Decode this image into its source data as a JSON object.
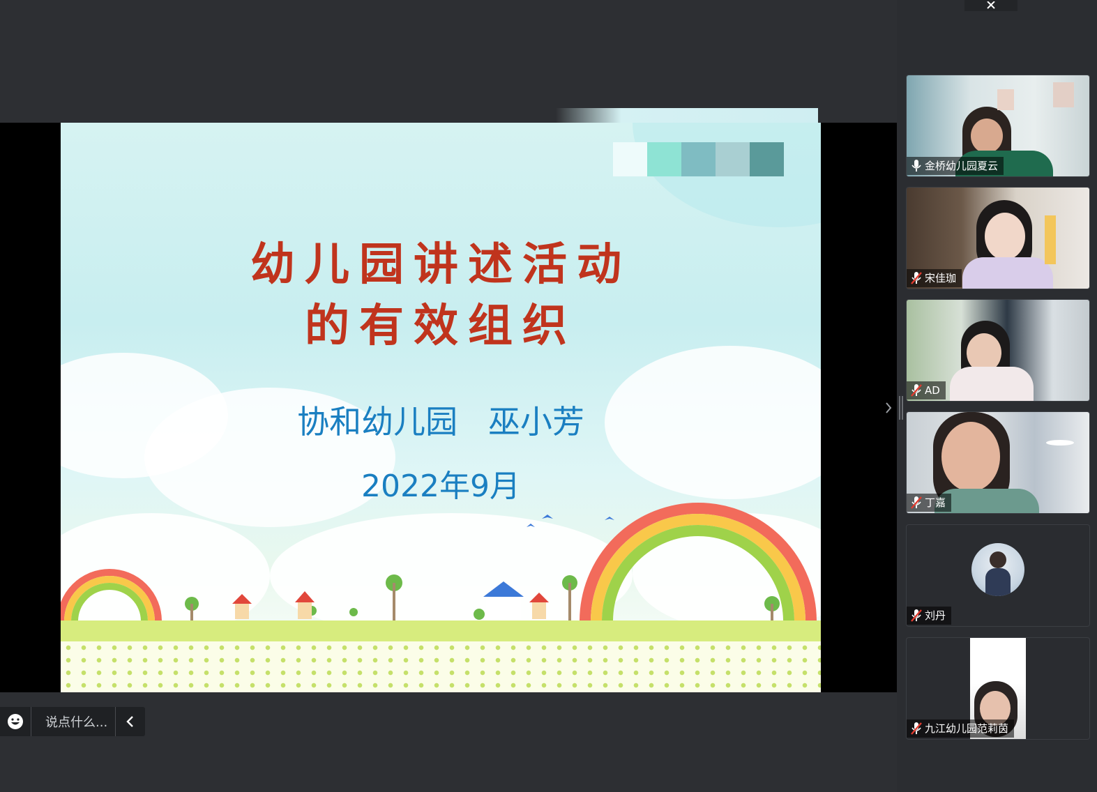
{
  "slide": {
    "title_line1": "幼儿园讲述活动",
    "title_line2": "的有效组织",
    "organization": "协和幼儿园   巫小芳",
    "date": "2022年9月",
    "swatch_colors": [
      "#eefbfb",
      "#8ee3d4",
      "#7fbcc2",
      "#a9cfd2",
      "#5a9a9a"
    ]
  },
  "chat": {
    "placeholder": "说点什么..."
  },
  "participants": [
    {
      "name": "金桥幼儿园夏云",
      "mic": "on"
    },
    {
      "name": "宋佳珈",
      "mic": "muted"
    },
    {
      "name": "AD",
      "mic": "muted"
    },
    {
      "name": "丁嘉",
      "mic": "muted"
    },
    {
      "name": "刘丹",
      "mic": "muted"
    },
    {
      "name": "九江幼儿园范莉茵",
      "mic": "muted"
    }
  ]
}
